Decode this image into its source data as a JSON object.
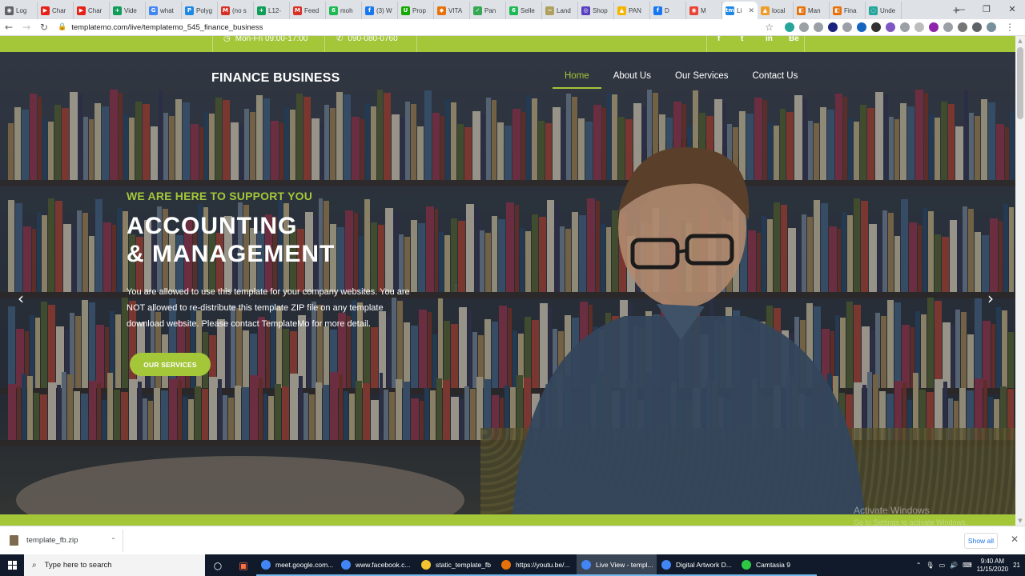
{
  "browser": {
    "tabs": [
      {
        "label": "Log",
        "color": "#5f6368",
        "glyph": "◉"
      },
      {
        "label": "Char",
        "color": "#e62117",
        "glyph": "▶"
      },
      {
        "label": "Char",
        "color": "#e62117",
        "glyph": "▶"
      },
      {
        "label": "Vide",
        "color": "#0f9d58",
        "glyph": "+"
      },
      {
        "label": "what",
        "color": "#4285f4",
        "glyph": "G"
      },
      {
        "label": "Polyg",
        "color": "#1e88e5",
        "glyph": "P"
      },
      {
        "label": "(no s",
        "color": "#d93025",
        "glyph": "M"
      },
      {
        "label": "L12-",
        "color": "#0f9d58",
        "glyph": "+"
      },
      {
        "label": "Feed",
        "color": "#d93025",
        "glyph": "M"
      },
      {
        "label": "moh",
        "color": "#1db954",
        "glyph": "6"
      },
      {
        "label": "(3) W",
        "color": "#1877f2",
        "glyph": "f"
      },
      {
        "label": "Prop",
        "color": "#14a800",
        "glyph": "U"
      },
      {
        "label": "VITA",
        "color": "#e8710a",
        "glyph": "◆"
      },
      {
        "label": "Pan",
        "color": "#34a853",
        "glyph": "✓"
      },
      {
        "label": "Selle",
        "color": "#1db954",
        "glyph": "6"
      },
      {
        "label": "Land",
        "color": "#b0a060",
        "glyph": "~"
      },
      {
        "label": "Shop",
        "color": "#5a3fc0",
        "glyph": "◎"
      },
      {
        "label": "PAN",
        "color": "#f4b400",
        "glyph": "▲"
      },
      {
        "label": "D",
        "color": "#1877f2",
        "glyph": "f"
      },
      {
        "label": "M",
        "color": "#ea4335",
        "glyph": "◉"
      },
      {
        "label": "Li",
        "color": "#1e88e5",
        "glyph": "tm",
        "active": true
      },
      {
        "label": "local",
        "color": "#f09d28",
        "glyph": "▲"
      },
      {
        "label": "Man",
        "color": "#e8710a",
        "glyph": "◧"
      },
      {
        "label": "Fina",
        "color": "#e8710a",
        "glyph": "◧"
      },
      {
        "label": "Unde",
        "color": "#26a69a",
        "glyph": "◌"
      }
    ],
    "url": "templatemo.com/live/templatemo_545_finance_business"
  },
  "site": {
    "top_hours": "Mon-Fri 09:00-17:00",
    "top_phone": "090-080-0760",
    "social": [
      "f",
      "t",
      "in",
      "Be"
    ],
    "logo": "FINANCE BUSINESS",
    "nav": [
      "Home",
      "About Us",
      "Our Services",
      "Contact Us"
    ],
    "kicker": "WE ARE HERE TO SUPPORT YOU",
    "heading_line1": "ACCOUNTING",
    "heading_line2": "& MANAGEMENT",
    "body": "You are allowed to use this template for your company websites. You are NOT allowed to re-distribute this template ZIP file on any template download website. Please contact TemplateMo for more detail.",
    "cta": "OUR SERVICES",
    "accent": "#a4c639"
  },
  "overlay": {
    "activate_title": "Activate Windows",
    "activate_sub": "Go to Settings to activate Windows."
  },
  "downloads": {
    "file": "template_fb.zip",
    "show_all": "Show all"
  },
  "taskbar": {
    "search_placeholder": "Type here to search",
    "apps": [
      {
        "label": "meet.google.com...",
        "color": "#4285f4"
      },
      {
        "label": "www.facebook.c...",
        "color": "#4285f4"
      },
      {
        "label": "static_template_fb",
        "color": "#f4c430"
      },
      {
        "label": "https://youtu.be/...",
        "color": "#e8710a"
      },
      {
        "label": "Live View - templ...",
        "color": "#4285f4",
        "active": true
      },
      {
        "label": "Digital Artwork D...",
        "color": "#4285f4"
      },
      {
        "label": "Camtasia 9",
        "color": "#2ec845"
      }
    ],
    "time": "9:40 AM",
    "date": "11/15/2020",
    "notif": "21"
  }
}
